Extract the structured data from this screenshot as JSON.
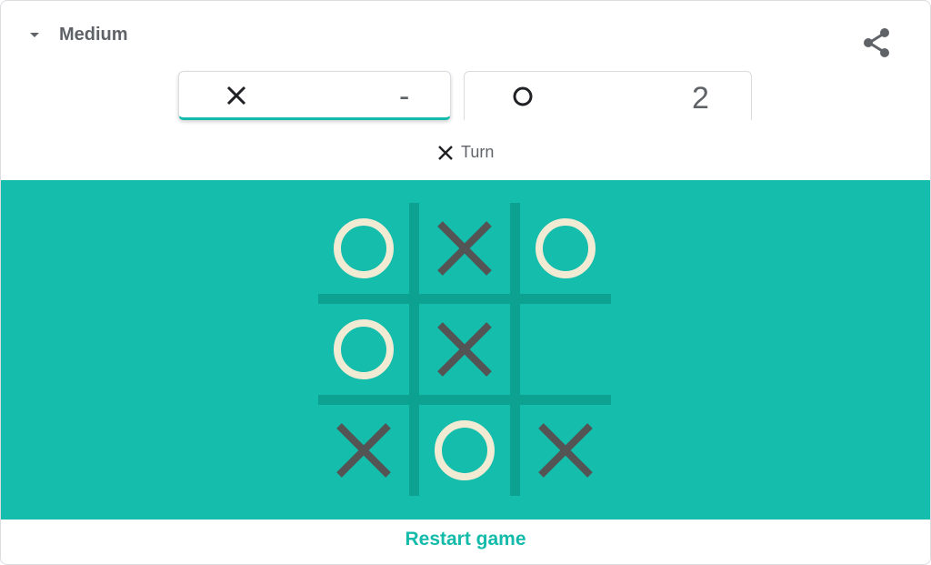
{
  "header": {
    "difficulty_label": "Medium",
    "dropdown_icon": "caret-down-icon",
    "share_icon": "share-icon"
  },
  "scoreboard": {
    "x_player": {
      "mark": "X",
      "score": "-",
      "active": true
    },
    "o_player": {
      "mark": "O",
      "score": "2",
      "active": false
    }
  },
  "turn": {
    "mark": "X",
    "label": "Turn"
  },
  "board": {
    "cells": [
      "O",
      "X",
      "O",
      "O",
      "X",
      "",
      "X",
      "O",
      "X"
    ]
  },
  "restart_label": "Restart game",
  "colors": {
    "board_background": "#14bdac",
    "grid_lines": "#0da192",
    "x_mark": "#545454",
    "o_mark": "#f2ebd3",
    "accent": "#14bbaa",
    "text": "#5f6368"
  }
}
